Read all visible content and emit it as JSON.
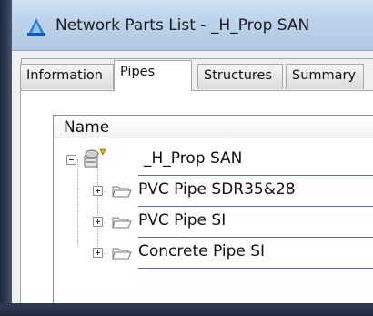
{
  "window": {
    "title": "Network Parts List - _H_Prop SAN"
  },
  "tabs": [
    {
      "label": "Information",
      "active": false
    },
    {
      "label": "Pipes",
      "active": true
    },
    {
      "label": "Structures",
      "active": false
    },
    {
      "label": "Summary",
      "active": false
    }
  ],
  "list": {
    "column_header": "Name",
    "root": {
      "label": "_H_Prop SAN",
      "expanded": true,
      "icon": "pipe-network-icon"
    },
    "children": [
      {
        "label": "PVC Pipe SDR35&28",
        "icon": "folder-icon",
        "expanded": false
      },
      {
        "label": "PVC Pipe SI",
        "icon": "folder-icon",
        "expanded": false
      },
      {
        "label": "Concrete Pipe SI",
        "icon": "folder-icon",
        "expanded": false
      }
    ]
  },
  "colors": {
    "selection_line": "#4f6ed4",
    "frame_dark": "#2f3b55",
    "titlebar": "#bcd2ea"
  }
}
